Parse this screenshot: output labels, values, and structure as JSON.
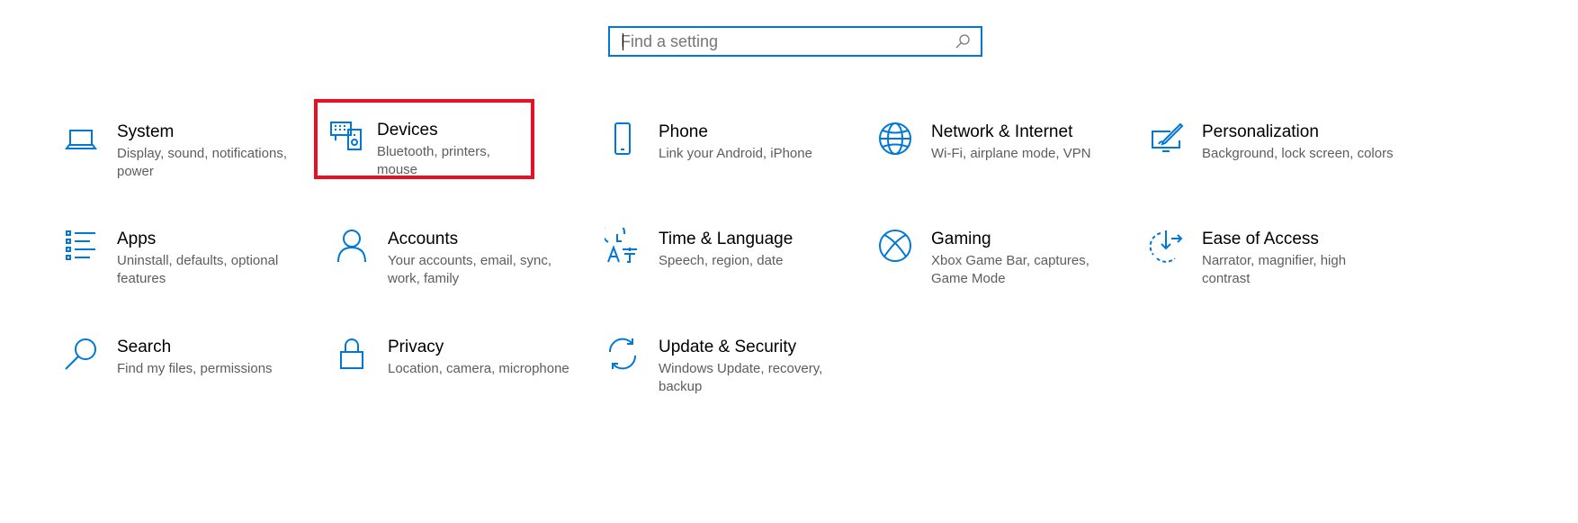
{
  "search": {
    "placeholder": "Find a setting"
  },
  "accent_color": "#0078d7",
  "highlight_color": "#e81123",
  "categories": [
    {
      "title": "System",
      "description": "Display, sound, notifications, power",
      "icon": "laptop-icon"
    },
    {
      "title": "Devices",
      "description": "Bluetooth, printers, mouse",
      "icon": "devices-icon",
      "highlighted": true
    },
    {
      "title": "Phone",
      "description": "Link your Android, iPhone",
      "icon": "phone-icon"
    },
    {
      "title": "Network & Internet",
      "description": "Wi-Fi, airplane mode, VPN",
      "icon": "globe-icon"
    },
    {
      "title": "Personalization",
      "description": "Background, lock screen, colors",
      "icon": "personalization-icon"
    },
    {
      "title": "Apps",
      "description": "Uninstall, defaults, optional features",
      "icon": "apps-list-icon"
    },
    {
      "title": "Accounts",
      "description": "Your accounts, email, sync, work, family",
      "icon": "person-icon"
    },
    {
      "title": "Time & Language",
      "description": "Speech, region, date",
      "icon": "time-language-icon"
    },
    {
      "title": "Gaming",
      "description": "Xbox Game Bar, captures, Game Mode",
      "icon": "xbox-icon"
    },
    {
      "title": "Ease of Access",
      "description": "Narrator, magnifier, high contrast",
      "icon": "ease-of-access-icon"
    },
    {
      "title": "Search",
      "description": "Find my files, permissions",
      "icon": "magnifier-icon"
    },
    {
      "title": "Privacy",
      "description": "Location, camera, microphone",
      "icon": "lock-icon"
    },
    {
      "title": "Update & Security",
      "description": "Windows Update, recovery, backup",
      "icon": "sync-arrows-icon"
    }
  ]
}
